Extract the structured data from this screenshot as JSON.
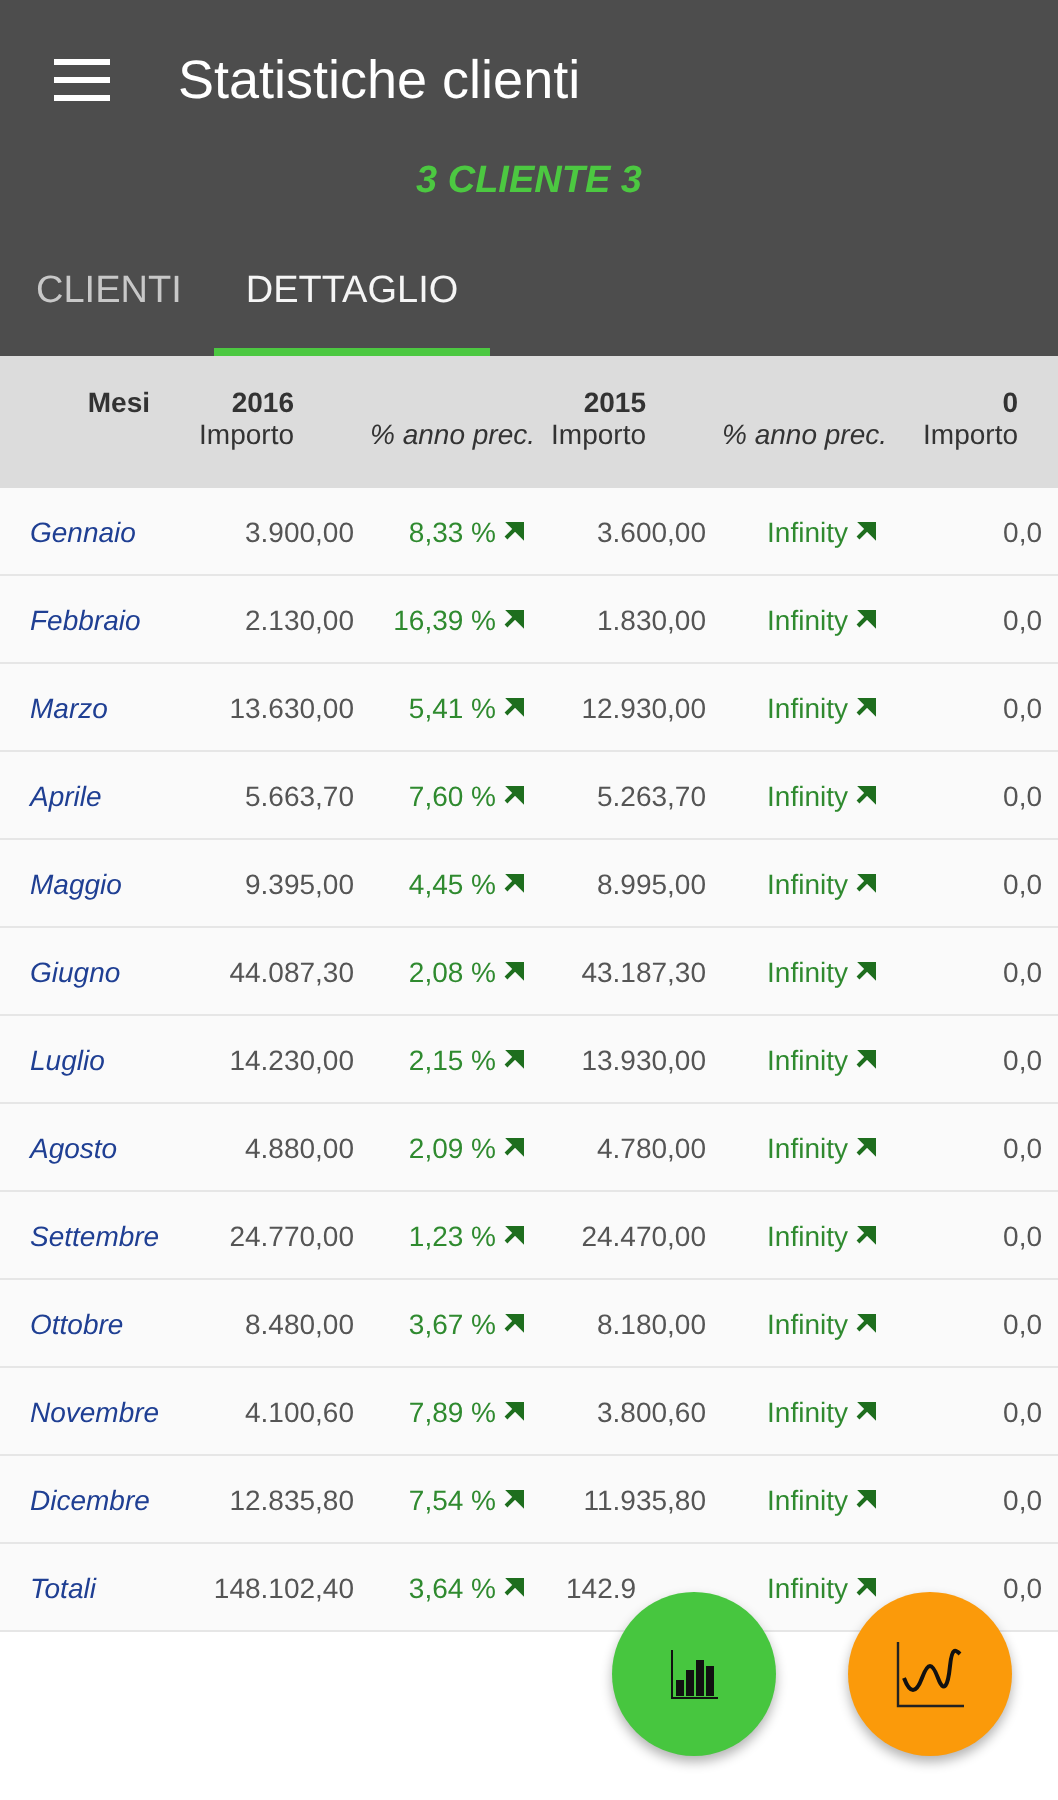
{
  "app_bar": {
    "title": "Statistiche clienti",
    "subtitle": "3 CLIENTE 3"
  },
  "tabs": [
    {
      "label": "CLIENTI",
      "selected": false
    },
    {
      "label": "DETTAGLIO",
      "selected": true
    }
  ],
  "table": {
    "month_header": "Mesi",
    "groups": [
      {
        "year": "2016",
        "columns": [
          {
            "label": "Importo",
            "kind": "amount"
          },
          {
            "label": "% anno prec.",
            "kind": "change"
          }
        ]
      },
      {
        "year": "2015",
        "columns": [
          {
            "label": "Importo",
            "kind": "amount"
          },
          {
            "label": "% anno prec.",
            "kind": "change"
          }
        ]
      },
      {
        "year": "0",
        "columns": [
          {
            "label": "Importo",
            "kind": "amount"
          }
        ]
      }
    ],
    "rows": [
      {
        "month": "Gennaio",
        "cells": [
          {
            "text": "3.900,00",
            "kind": "amount"
          },
          {
            "text": "8,33 %",
            "kind": "change",
            "up": true
          },
          {
            "text": "3.600,00",
            "kind": "amount"
          },
          {
            "text": "Infinity",
            "kind": "change",
            "up": true
          },
          {
            "text": "0,0",
            "kind": "amount"
          }
        ]
      },
      {
        "month": "Febbraio",
        "cells": [
          {
            "text": "2.130,00",
            "kind": "amount"
          },
          {
            "text": "16,39 %",
            "kind": "change",
            "up": true
          },
          {
            "text": "1.830,00",
            "kind": "amount"
          },
          {
            "text": "Infinity",
            "kind": "change",
            "up": true
          },
          {
            "text": "0,0",
            "kind": "amount"
          }
        ]
      },
      {
        "month": "Marzo",
        "cells": [
          {
            "text": "13.630,00",
            "kind": "amount"
          },
          {
            "text": "5,41 %",
            "kind": "change",
            "up": true
          },
          {
            "text": "12.930,00",
            "kind": "amount"
          },
          {
            "text": "Infinity",
            "kind": "change",
            "up": true
          },
          {
            "text": "0,0",
            "kind": "amount"
          }
        ]
      },
      {
        "month": "Aprile",
        "cells": [
          {
            "text": "5.663,70",
            "kind": "amount"
          },
          {
            "text": "7,60 %",
            "kind": "change",
            "up": true
          },
          {
            "text": "5.263,70",
            "kind": "amount"
          },
          {
            "text": "Infinity",
            "kind": "change",
            "up": true
          },
          {
            "text": "0,0",
            "kind": "amount"
          }
        ]
      },
      {
        "month": "Maggio",
        "cells": [
          {
            "text": "9.395,00",
            "kind": "amount"
          },
          {
            "text": "4,45 %",
            "kind": "change",
            "up": true
          },
          {
            "text": "8.995,00",
            "kind": "amount"
          },
          {
            "text": "Infinity",
            "kind": "change",
            "up": true
          },
          {
            "text": "0,0",
            "kind": "amount"
          }
        ]
      },
      {
        "month": "Giugno",
        "cells": [
          {
            "text": "44.087,30",
            "kind": "amount"
          },
          {
            "text": "2,08 %",
            "kind": "change",
            "up": true
          },
          {
            "text": "43.187,30",
            "kind": "amount"
          },
          {
            "text": "Infinity",
            "kind": "change",
            "up": true
          },
          {
            "text": "0,0",
            "kind": "amount"
          }
        ]
      },
      {
        "month": "Luglio",
        "cells": [
          {
            "text": "14.230,00",
            "kind": "amount"
          },
          {
            "text": "2,15 %",
            "kind": "change",
            "up": true
          },
          {
            "text": "13.930,00",
            "kind": "amount"
          },
          {
            "text": "Infinity",
            "kind": "change",
            "up": true
          },
          {
            "text": "0,0",
            "kind": "amount"
          }
        ]
      },
      {
        "month": "Agosto",
        "cells": [
          {
            "text": "4.880,00",
            "kind": "amount"
          },
          {
            "text": "2,09 %",
            "kind": "change",
            "up": true
          },
          {
            "text": "4.780,00",
            "kind": "amount"
          },
          {
            "text": "Infinity",
            "kind": "change",
            "up": true
          },
          {
            "text": "0,0",
            "kind": "amount"
          }
        ]
      },
      {
        "month": "Settembre",
        "cells": [
          {
            "text": "24.770,00",
            "kind": "amount"
          },
          {
            "text": "1,23 %",
            "kind": "change",
            "up": true
          },
          {
            "text": "24.470,00",
            "kind": "amount"
          },
          {
            "text": "Infinity",
            "kind": "change",
            "up": true
          },
          {
            "text": "0,0",
            "kind": "amount"
          }
        ]
      },
      {
        "month": "Ottobre",
        "cells": [
          {
            "text": "8.480,00",
            "kind": "amount"
          },
          {
            "text": "3,67 %",
            "kind": "change",
            "up": true
          },
          {
            "text": "8.180,00",
            "kind": "amount"
          },
          {
            "text": "Infinity",
            "kind": "change",
            "up": true
          },
          {
            "text": "0,0",
            "kind": "amount"
          }
        ]
      },
      {
        "month": "Novembre",
        "cells": [
          {
            "text": "4.100,60",
            "kind": "amount"
          },
          {
            "text": "7,89 %",
            "kind": "change",
            "up": true
          },
          {
            "text": "3.800,60",
            "kind": "amount"
          },
          {
            "text": "Infinity",
            "kind": "change",
            "up": true
          },
          {
            "text": "0,0",
            "kind": "amount"
          }
        ]
      },
      {
        "month": "Dicembre",
        "cells": [
          {
            "text": "12.835,80",
            "kind": "amount"
          },
          {
            "text": "7,54 %",
            "kind": "change",
            "up": true
          },
          {
            "text": "11.935,80",
            "kind": "amount"
          },
          {
            "text": "Infinity",
            "kind": "change",
            "up": true
          },
          {
            "text": "0,0",
            "kind": "amount"
          }
        ]
      },
      {
        "month": "Totali",
        "cells": [
          {
            "text": "148.102,40",
            "kind": "amount"
          },
          {
            "text": "3,64 %",
            "kind": "change",
            "up": true
          },
          {
            "text": "142.9",
            "kind": "clipped"
          },
          {
            "text": "Infinity",
            "kind": "change",
            "up": true
          },
          {
            "text": "0,0",
            "kind": "amount"
          }
        ]
      }
    ]
  },
  "fabs": [
    {
      "kind": "bar-chart",
      "color": "#47c63f"
    },
    {
      "kind": "line-chart",
      "color": "#fb9a0a"
    }
  ]
}
